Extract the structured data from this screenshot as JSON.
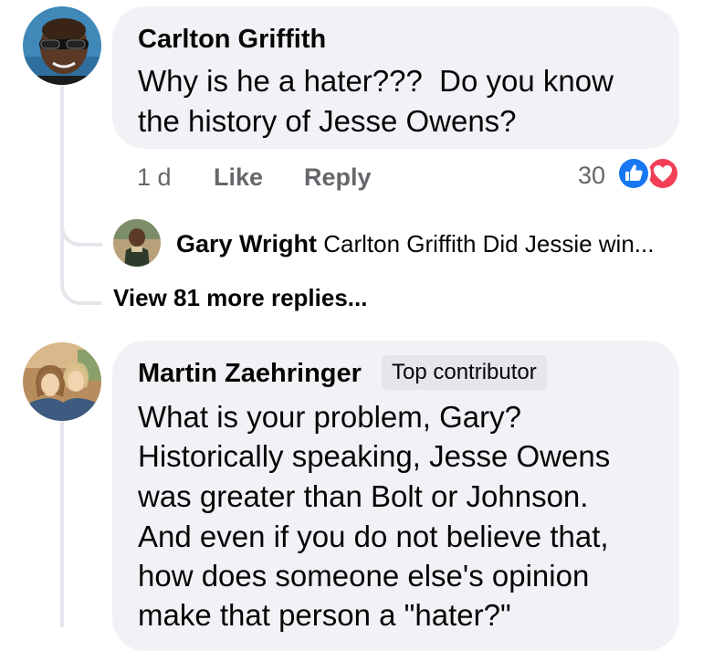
{
  "comments": [
    {
      "author": "Carlton Griffith",
      "text_lines": [
        "Why is he a hater???  Do you know",
        "the history of Jesse Owens?"
      ],
      "time": "1 d",
      "like_label": "Like",
      "reply_label": "Reply",
      "reaction_count": "30",
      "reaction_icons": [
        "like-icon",
        "love-icon"
      ],
      "replies_preview": {
        "author": "Gary Wright",
        "text": "Carlton Griffith Did Jessie win..."
      },
      "view_more_label": "View 81 more replies..."
    },
    {
      "author": "Martin Zaehringer",
      "badge": "Top contributor",
      "text_lines": [
        "What is your problem, Gary?",
        "Historically speaking, Jesse Owens",
        "was greater than Bolt or Johnson.",
        "And even if you do not believe that,",
        "how does someone else's opinion",
        "make that person a \"hater?\""
      ]
    }
  ],
  "colors": {
    "bubble": "#f0f2f5",
    "secondary_text": "#65676b",
    "like_blue": "#1877f2",
    "love_red": "#f33e58",
    "thread_line": "#e4e6eb"
  }
}
